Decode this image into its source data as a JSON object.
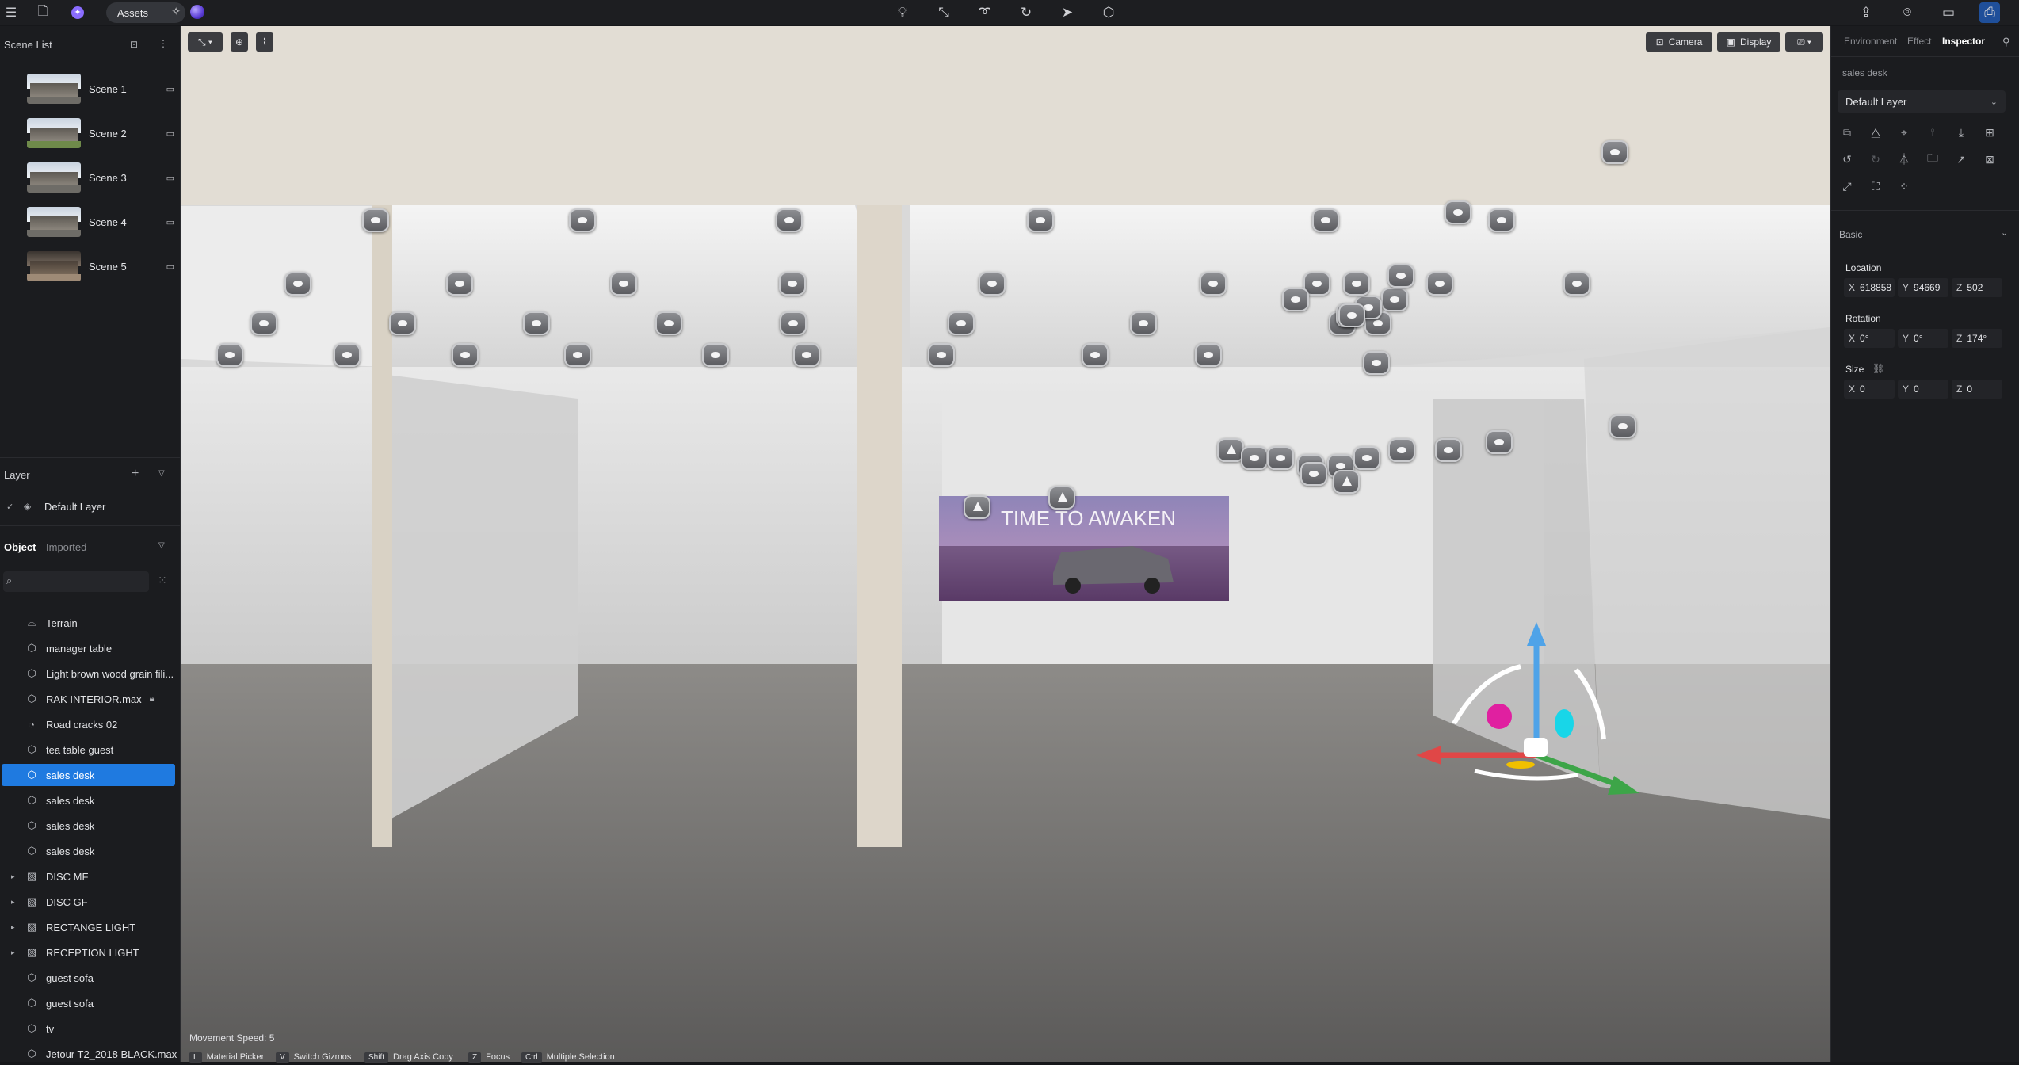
{
  "topbar": {
    "assets_label": "Assets",
    "tools": [
      "bulb-icon",
      "path-icon",
      "lasso-icon",
      "refresh-icon",
      "pointer-icon",
      "layer-icon"
    ],
    "right_tools": [
      "share-icon",
      "camera-icon",
      "video-icon",
      "inbox-icon"
    ]
  },
  "scene_list": {
    "title": "Scene List",
    "scenes": [
      {
        "label": "Scene 1"
      },
      {
        "label": "Scene 2"
      },
      {
        "label": "Scene 3"
      },
      {
        "label": "Scene 4"
      },
      {
        "label": "Scene 5"
      }
    ]
  },
  "layer_panel": {
    "title": "Layer",
    "layers": [
      {
        "label": "Default Layer"
      }
    ]
  },
  "object_panel": {
    "tabs": {
      "object": "Object",
      "imported": "Imported"
    },
    "items": [
      {
        "label": "Terrain",
        "icon": "terrain-icon"
      },
      {
        "label": "manager table",
        "icon": "cube-icon"
      },
      {
        "label": "Light brown wood grain fili...",
        "icon": "cube-icon"
      },
      {
        "label": "RAK INTERIOR.max",
        "icon": "cube-icon"
      },
      {
        "label": "Road cracks 02",
        "icon": "decal-icon"
      },
      {
        "label": "tea table guest",
        "icon": "cube-icon"
      },
      {
        "label": "sales desk",
        "icon": "cube-icon",
        "selected": true
      },
      {
        "label": "sales desk",
        "icon": "cube-icon"
      },
      {
        "label": "sales desk",
        "icon": "cube-icon"
      },
      {
        "label": "sales desk",
        "icon": "cube-icon"
      },
      {
        "label": "DISC MF",
        "icon": "group-icon",
        "expandable": true
      },
      {
        "label": "DISC GF",
        "icon": "group-icon",
        "expandable": true
      },
      {
        "label": "RECTANGE LIGHT",
        "icon": "group-icon",
        "expandable": true
      },
      {
        "label": "RECEPTION LIGHT",
        "icon": "group-icon",
        "expandable": true
      },
      {
        "label": "guest sofa",
        "icon": "cube-icon"
      },
      {
        "label": "guest sofa",
        "icon": "cube-icon"
      },
      {
        "label": "tv",
        "icon": "cube-icon"
      },
      {
        "label": "Jetour T2_2018 BLACK.max",
        "icon": "cube-icon"
      }
    ]
  },
  "viewport": {
    "camera_label": "Camera",
    "display_label": "Display",
    "banner_text": "TIME TO AWAKEN",
    "movement_speed": "Movement Speed: 5",
    "hints": [
      {
        "key": "L",
        "label": "Material Picker"
      },
      {
        "key": "V",
        "label": "Switch Gizmos"
      },
      {
        "key": "Shift",
        "label": "Drag Axis Copy"
      },
      {
        "key": "Z",
        "label": "Focus"
      },
      {
        "key": "Ctrl",
        "label": "Multiple Selection"
      }
    ]
  },
  "inspector": {
    "tabs": {
      "environment": "Environment",
      "effect": "Effect",
      "inspector": "Inspector"
    },
    "object_name": "sales desk",
    "layer_value": "Default Layer",
    "basic_label": "Basic",
    "location_label": "Location",
    "location": {
      "x": "618858",
      "y": "94669",
      "z": "502"
    },
    "rotation_label": "Rotation",
    "rotation": {
      "x": "0°",
      "y": "0°",
      "z": "174°"
    },
    "size_label": "Size",
    "size": {
      "x": "0",
      "y": "0",
      "z": "0"
    },
    "axis_x": "X",
    "axis_y": "Y",
    "axis_z": "Z"
  }
}
